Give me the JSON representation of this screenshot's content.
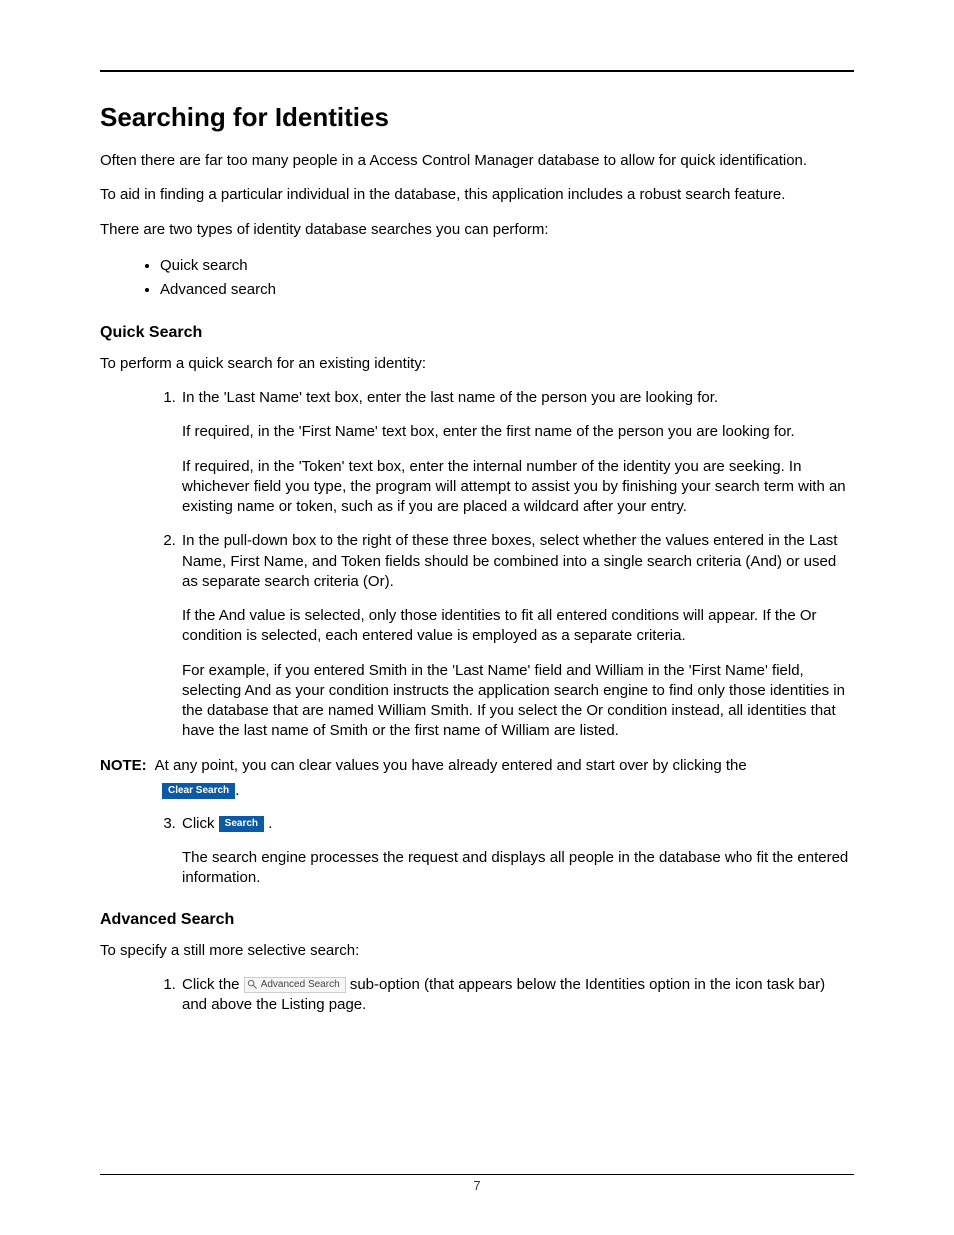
{
  "heading": "Searching for Identities",
  "intro_1": "Often there are far too many people in a Access Control Manager database to allow for quick identification.",
  "intro_2": "To aid in finding a particular individual in the database, this application includes a robust search feature.",
  "intro_3": "There are two types of identity database searches you can perform:",
  "bullets": {
    "b1": "Quick search",
    "b2": "Advanced search"
  },
  "quick": {
    "heading": "Quick Search",
    "lead": "To perform a quick search for an existing identity:",
    "step1_a": "In the 'Last Name' text box, enter the last name of the person you are looking for.",
    "step1_b": "If required, in the 'First Name' text box, enter the first name of the person you are looking for.",
    "step1_c": "If required, in the 'Token' text box, enter the internal number of the identity you are seeking. In whichever field you type, the program will attempt to assist you by finishing your search term with an existing name or token, such as if you are placed a wildcard after your entry.",
    "step2_a": "In the pull-down box to the right of these three boxes, select whether the values entered in the Last Name, First Name, and Token fields should be combined into a single search criteria (And) or used as separate search criteria (Or).",
    "step2_b": "If the And value is selected, only those identities to fit all entered conditions will appear. If the Or condition is selected, each entered value is employed as a separate criteria.",
    "step2_c": "For example, if you entered Smith in the 'Last Name' field and William in the 'First Name' field, selecting And as your condition instructs the application search engine to find only those identities in the database that are named William Smith. If you select the Or condition instead, all identities that have the last name of Smith or the first name of William are listed.",
    "step3_a": "Click ",
    "step3_b": "The search engine processes the request and displays all people in the database who fit the entered information."
  },
  "note": {
    "label": "NOTE:",
    "text": "At any point, you can clear values you have already entered and start over by clicking the",
    "tail": "."
  },
  "buttons": {
    "clear_search": "Clear Search",
    "search": "Search",
    "advanced_search": "Advanced Search"
  },
  "advanced": {
    "heading": "Advanced Search",
    "lead": "To specify a still more selective search:",
    "step1_a": "Click the ",
    "step1_b": " sub-option (that appears below the Identities option in the icon task bar) and above the Listing page."
  },
  "page_number": "7"
}
